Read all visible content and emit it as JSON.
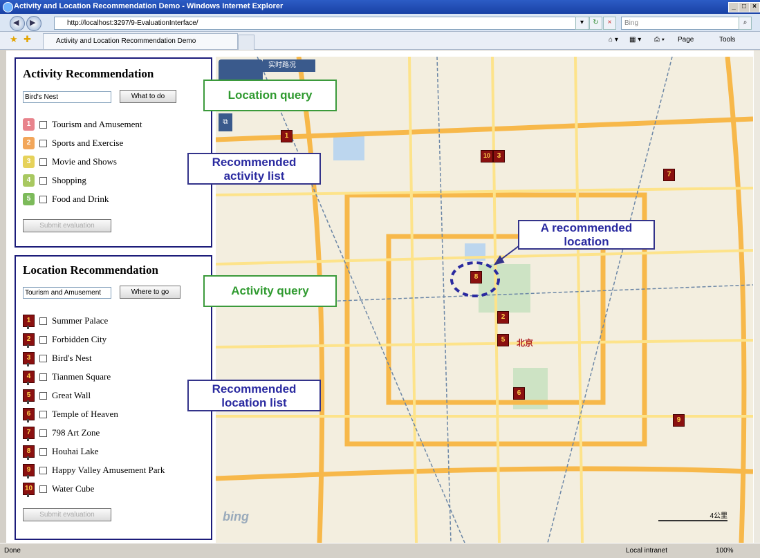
{
  "window": {
    "title": "Activity and Location Recommendation Demo - Windows Internet Explorer"
  },
  "browser": {
    "url": "http://localhost:3297/9-EvaluationInterface/",
    "search_placeholder": "Bing",
    "tab_title": "Activity and Location Recommendation Demo",
    "tools": {
      "page": "Page",
      "tools": "Tools"
    }
  },
  "activity_panel": {
    "title": "Activity Recommendation",
    "query_value": "Bird's Nest",
    "button": "What to do",
    "items": [
      {
        "n": "1",
        "label": "Tourism and Amusement",
        "color": "#e8838c"
      },
      {
        "n": "2",
        "label": "Sports and Exercise",
        "color": "#f2a65a"
      },
      {
        "n": "3",
        "label": "Movie and Shows",
        "color": "#e6d25a"
      },
      {
        "n": "4",
        "label": "Shopping",
        "color": "#a8c860"
      },
      {
        "n": "5",
        "label": "Food and Drink",
        "color": "#7cba5a"
      }
    ],
    "submit": "Submit evaluation"
  },
  "location_panel": {
    "title": "Location Recommendation",
    "query_value": "Tourism and Amusement",
    "button": "Where to go",
    "items": [
      {
        "n": "1",
        "label": "Summer Palace"
      },
      {
        "n": "2",
        "label": "Forbidden City"
      },
      {
        "n": "3",
        "label": "Bird's Nest"
      },
      {
        "n": "4",
        "label": "Tianmen Square"
      },
      {
        "n": "5",
        "label": "Great Wall"
      },
      {
        "n": "6",
        "label": "Temple of Heaven"
      },
      {
        "n": "7",
        "label": "798 Art Zone"
      },
      {
        "n": "8",
        "label": "Houhai Lake"
      },
      {
        "n": "9",
        "label": "Happy Valley Amusement Park"
      },
      {
        "n": "10",
        "label": "Water Cube"
      }
    ],
    "submit": "Submit evaluation"
  },
  "annotations": {
    "location_query": "Location query",
    "recommended_activity_1": "Recommended",
    "recommended_activity_2": "activity list",
    "a_recommended_1": "A recommended",
    "a_recommended_2": "location",
    "activity_query": "Activity query",
    "recommended_location_1": "Recommended",
    "recommended_location_2": "location list"
  },
  "map": {
    "realtime_label": "实时路况",
    "beijing_label": "北京",
    "scale_label": "4公里",
    "bing": "bing",
    "pins": [
      "1",
      "10",
      "3",
      "7",
      "8",
      "2",
      "5",
      "6",
      "9"
    ]
  },
  "status": {
    "left": "Done",
    "zone": "Local intranet",
    "zoom": "100%"
  }
}
